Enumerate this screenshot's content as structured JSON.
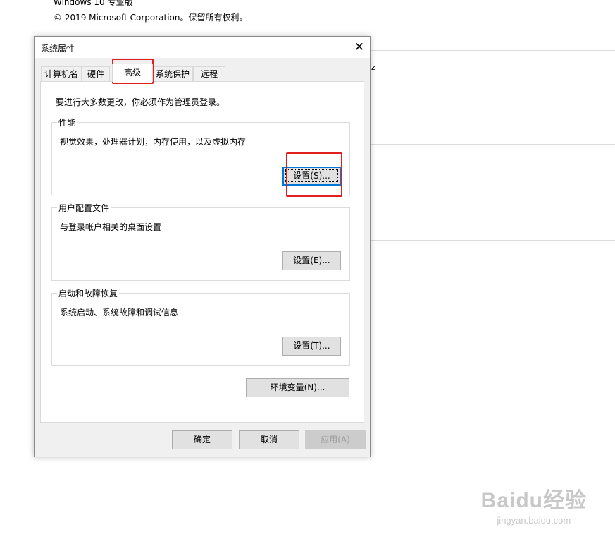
{
  "background": {
    "edition_text": "Windows 10 专业版",
    "copyright_text": "© 2019 Microsoft Corporation。保留所有权利。",
    "fragment_text": "z"
  },
  "dialog": {
    "title": "系统属性",
    "close_icon": "close-icon",
    "tabs": [
      {
        "label": "计算机名"
      },
      {
        "label": "硬件"
      },
      {
        "label": "高级",
        "active": true
      },
      {
        "label": "系统保护"
      },
      {
        "label": "远程"
      }
    ],
    "admin_note": "要进行大多数更改，你必须作为管理员登录。",
    "groups": {
      "performance": {
        "label": "性能",
        "description": "视觉效果，处理器计划，内存使用，以及虚拟内存",
        "button": "设置(S)..."
      },
      "user_profiles": {
        "label": "用户配置文件",
        "description": "与登录帐户相关的桌面设置",
        "button": "设置(E)..."
      },
      "startup_recovery": {
        "label": "启动和故障恢复",
        "description": "系统启动、系统故障和调试信息",
        "button": "设置(T)..."
      }
    },
    "env_button": "环境变量(N)...",
    "footer": {
      "ok": "确定",
      "cancel": "取消",
      "apply": "应用(A)"
    }
  },
  "watermark": {
    "logo": "Baidu经验",
    "url": "jingyan.baidu.com"
  },
  "colors": {
    "highlight": "#e02020",
    "focus": "#0078d7",
    "dialog_bg": "#f0f0f0"
  }
}
